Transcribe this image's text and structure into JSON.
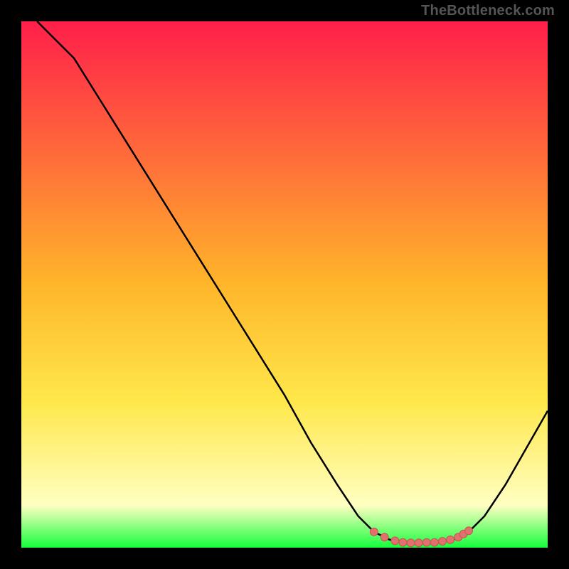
{
  "watermark": "TheBottleneck.com",
  "colors": {
    "bg": "#000000",
    "gradient_top": "#ff1f4a",
    "gradient_mid_upper": "#ff6a3a",
    "gradient_mid": "#ffb62a",
    "gradient_lower": "#ffe74a",
    "gradient_pale": "#ffffc2",
    "gradient_bottom": "#14ff3c",
    "curve": "#000000",
    "dot_fill": "#e2706d",
    "dot_stroke": "#c25754"
  },
  "chart_data": {
    "type": "line",
    "title": "",
    "xlabel": "",
    "ylabel": "",
    "xlim": [
      0,
      100
    ],
    "ylim": [
      0,
      100
    ],
    "curve": [
      {
        "x": 3,
        "y": 100
      },
      {
        "x": 6,
        "y": 97
      },
      {
        "x": 10,
        "y": 93
      },
      {
        "x": 15,
        "y": 85
      },
      {
        "x": 20,
        "y": 77
      },
      {
        "x": 25,
        "y": 69
      },
      {
        "x": 30,
        "y": 61
      },
      {
        "x": 35,
        "y": 53
      },
      {
        "x": 40,
        "y": 45
      },
      {
        "x": 45,
        "y": 37
      },
      {
        "x": 50,
        "y": 29
      },
      {
        "x": 55,
        "y": 20
      },
      {
        "x": 60,
        "y": 12
      },
      {
        "x": 64,
        "y": 6
      },
      {
        "x": 67,
        "y": 3
      },
      {
        "x": 70,
        "y": 1.5
      },
      {
        "x": 74,
        "y": 1
      },
      {
        "x": 78,
        "y": 1
      },
      {
        "x": 82,
        "y": 1.5
      },
      {
        "x": 85,
        "y": 3
      },
      {
        "x": 88,
        "y": 6
      },
      {
        "x": 92,
        "y": 12
      },
      {
        "x": 96,
        "y": 19
      },
      {
        "x": 100,
        "y": 26
      }
    ],
    "dots": [
      {
        "x": 67,
        "y": 3
      },
      {
        "x": 69,
        "y": 2
      },
      {
        "x": 71,
        "y": 1.3
      },
      {
        "x": 72.5,
        "y": 1
      },
      {
        "x": 74,
        "y": 0.9
      },
      {
        "x": 75.5,
        "y": 0.9
      },
      {
        "x": 77,
        "y": 1
      },
      {
        "x": 78.5,
        "y": 1
      },
      {
        "x": 80,
        "y": 1.2
      },
      {
        "x": 81.5,
        "y": 1.5
      },
      {
        "x": 83,
        "y": 2
      },
      {
        "x": 84,
        "y": 2.6
      },
      {
        "x": 85,
        "y": 3.2
      }
    ]
  }
}
